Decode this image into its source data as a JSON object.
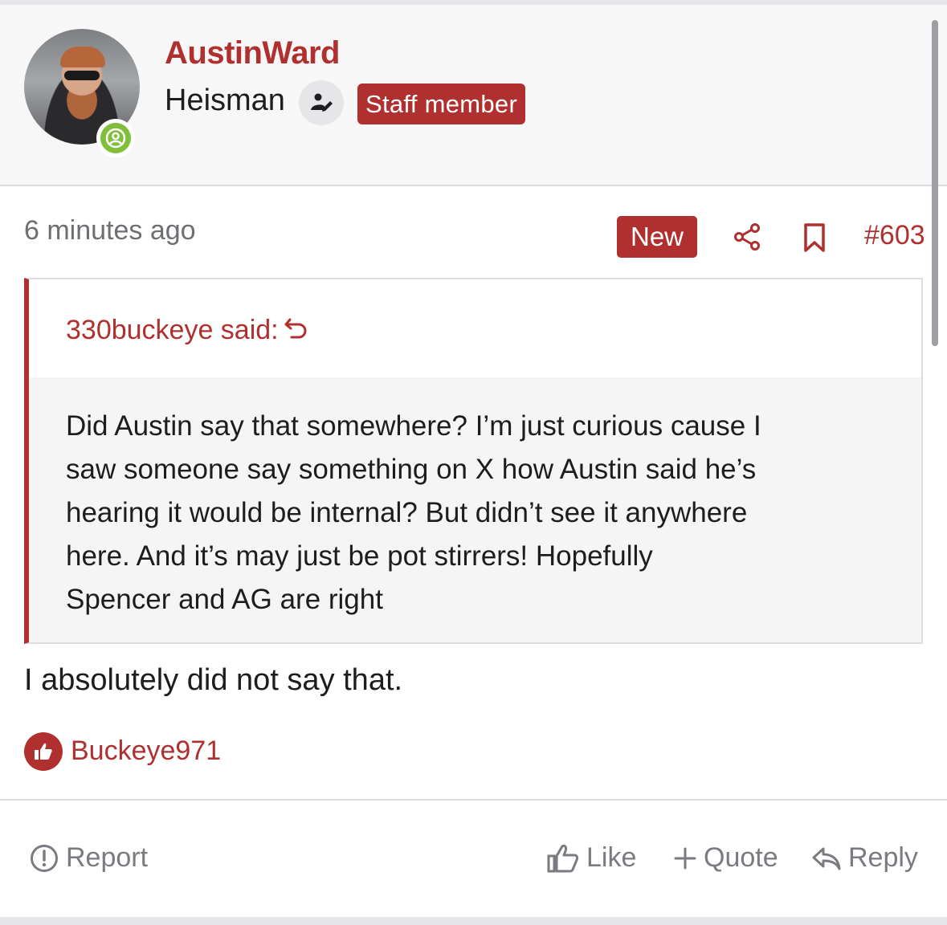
{
  "user": {
    "name": "AustinWard",
    "title": "Heisman",
    "badge": "Staff member",
    "online": true
  },
  "post": {
    "time": "6 minutes ago",
    "new_label": "New",
    "number": "#603",
    "quote": {
      "author": "330buckeye said:",
      "lines": [
        "Did Austin say that somewhere? I’m just curious cause I",
        "saw someone say something on X how Austin said he’s",
        "hearing it would be internal? But didn’t see it anywhere",
        "here. And it’s may just be pot stirrers! Hopefully",
        "Spencer and AG are right"
      ]
    },
    "text": "I absolutely did not say that.",
    "reaction_user": "Buckeye971"
  },
  "actions": {
    "report": "Report",
    "like": "Like",
    "quote": "Quote",
    "reply": "Reply"
  },
  "colors": {
    "accent": "#b0302f",
    "muted": "#7a7a80",
    "online": "#7fbf3a"
  }
}
